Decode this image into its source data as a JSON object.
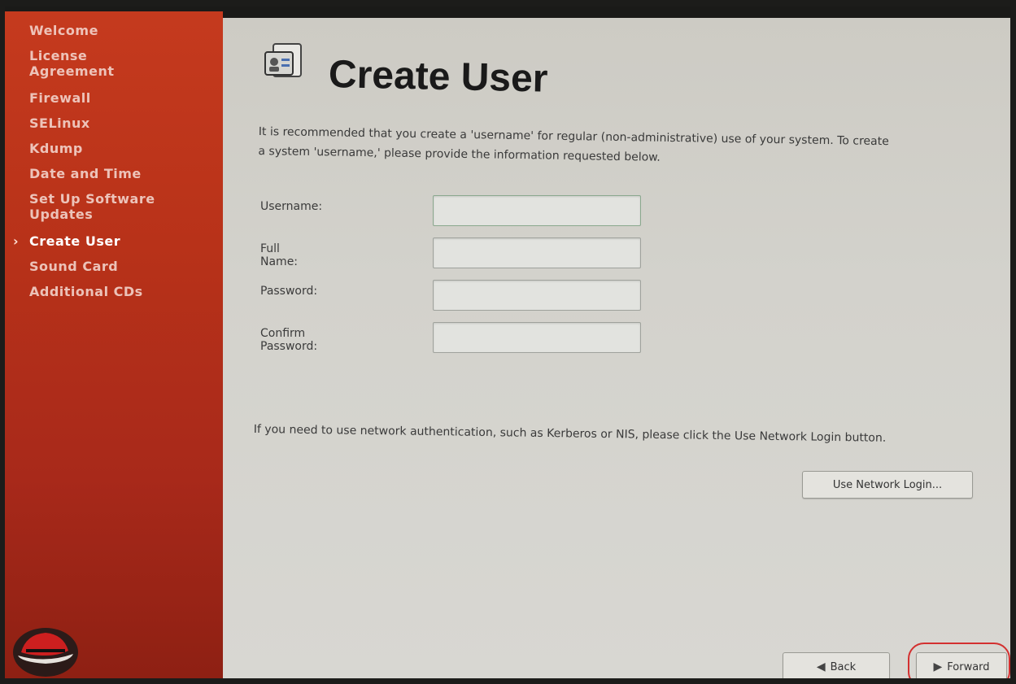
{
  "sidebar": {
    "items": [
      {
        "label": "Welcome"
      },
      {
        "label": "License Agreement"
      },
      {
        "label": "Firewall"
      },
      {
        "label": "SELinux"
      },
      {
        "label": "Kdump"
      },
      {
        "label": "Date and Time"
      },
      {
        "label": "Set Up Software Updates"
      },
      {
        "label": "Create User"
      },
      {
        "label": "Sound Card"
      },
      {
        "label": "Additional CDs"
      }
    ],
    "active_index": 7
  },
  "page": {
    "title": "Create User",
    "icon": "user-card-icon",
    "intro": "It is recommended that you create a 'username' for regular (non-administrative) use of your system. To create a system 'username,' please provide the information requested below."
  },
  "form": {
    "username_label": "Username:",
    "username_value": "",
    "fullname_label": "Full Name:",
    "fullname_value": "",
    "password_label": "Password:",
    "password_value": "",
    "confirm_label": "Confirm Password:",
    "confirm_value": ""
  },
  "network": {
    "text": "If you need to use network authentication, such as Kerberos or NIS, please click the Use Network Login button.",
    "button_label": "Use Network Login..."
  },
  "footer": {
    "back_label": "Back",
    "forward_label": "Forward"
  },
  "colors": {
    "sidebar": "#b83219",
    "content_bg": "#d3d2cc",
    "highlight": "#d33030"
  }
}
